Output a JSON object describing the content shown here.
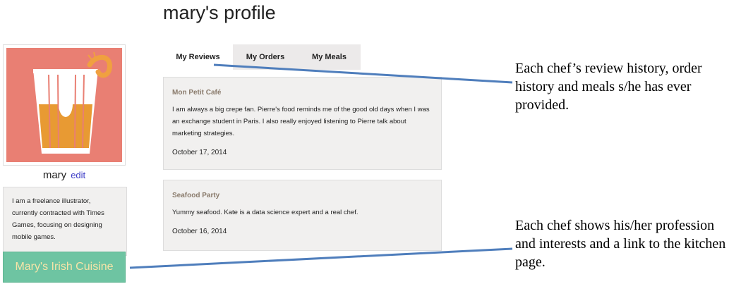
{
  "page_title": "mary's profile",
  "user": {
    "name": "mary",
    "edit_label": "edit"
  },
  "bio": "I am a freelance illustrator, currently contracted with Times Games, focusing on designing mobile games.",
  "kitchen_button": "Mary's Irish Cuisine",
  "tabs": [
    {
      "label": "My Reviews",
      "active": true
    },
    {
      "label": "My Orders",
      "active": false
    },
    {
      "label": "My Meals",
      "active": false
    }
  ],
  "reviews": [
    {
      "restaurant": "Mon Petit Café",
      "text": "I am always a big crepe fan. Pierre's food reminds me of the good old days when I was an exchange student in Paris. I also really enjoyed listening to Pierre talk about marketing strategies.",
      "date": "October 17, 2014"
    },
    {
      "restaurant": "Seafood Party",
      "text": "Yummy seafood. Kate is a data science expert and a real chef.",
      "date": "October 16, 2014"
    }
  ],
  "annotations": [
    "Each chef’s review history, order history and meals s/he has ever provided.",
    "Each chef shows his/her profession and interests and a link to the kitchen page."
  ],
  "colors": {
    "avatar_bg": "#e97f73",
    "kitchen_button_bg": "#6ec4a2",
    "kitchen_button_text": "#f6e4a8",
    "annotation_line": "#4f7ebc",
    "edit_link": "#3d3dc7"
  },
  "icons": {
    "avatar": "drink-glass-with-shrimp-icon"
  }
}
